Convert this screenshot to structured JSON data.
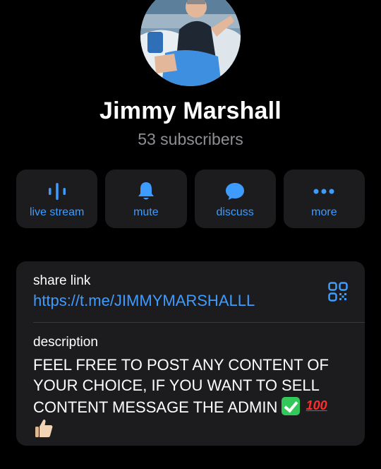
{
  "profile": {
    "name": "Jimmy Marshall",
    "subscribers": "53 subscribers"
  },
  "actions": [
    {
      "label": "live stream",
      "icon": "live-stream-icon"
    },
    {
      "label": "mute",
      "icon": "bell-icon"
    },
    {
      "label": "discuss",
      "icon": "chat-bubble-icon"
    },
    {
      "label": "more",
      "icon": "more-dots-icon"
    }
  ],
  "info": {
    "share_label": "share link",
    "share_url": "https://t.me/JIMMYMARSHALLL",
    "qr_icon": "qr-code-icon",
    "description_label": "description",
    "description_text": "FEEL FREE TO POST ANY CONTENT OF YOUR CHOICE, IF YOU WANT TO SELL CONTENT MESSAGE THE ADMIN",
    "emoji_100": "100"
  },
  "colors": {
    "background": "#000000",
    "card": "#1c1c1e",
    "accent": "#3e9bff",
    "secondary_text": "#8e8e93"
  }
}
